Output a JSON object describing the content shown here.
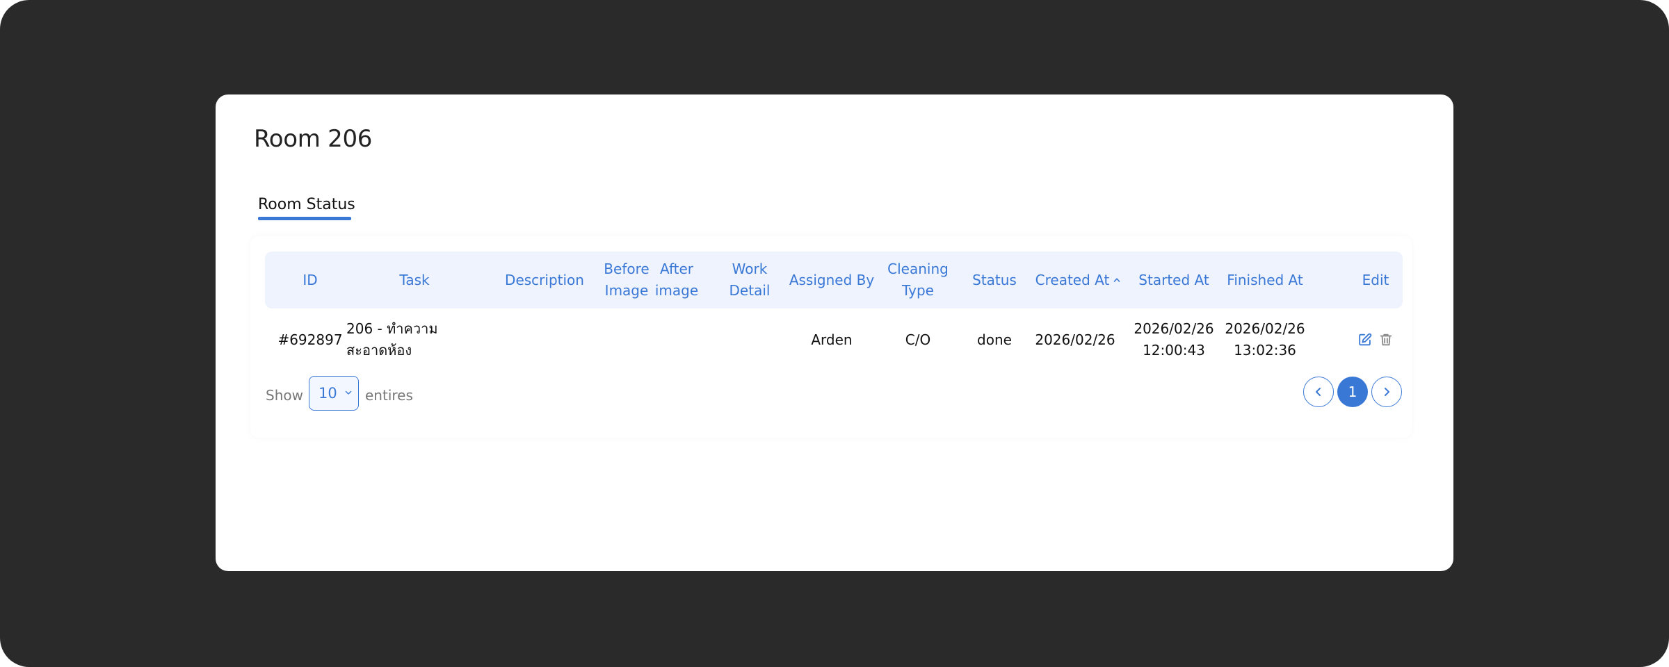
{
  "page": {
    "title": "Room 206"
  },
  "tabs": [
    {
      "label": "Room Status",
      "active": true
    }
  ],
  "table": {
    "columns": [
      "ID",
      "Task",
      "Description",
      "Before\nImage",
      "After\nimage",
      "Work\nDetail",
      "Assigned By",
      "Cleaning\nType",
      "Status",
      "Created At",
      "Started At",
      "Finished At",
      "Edit"
    ],
    "sorted_column": "Created At",
    "sort_direction": "ascending",
    "rows": [
      {
        "id": "#692897",
        "task": "206 - ทำความ\nสะอาดห้อง",
        "description": "",
        "before_image": "",
        "after_image": "",
        "work_detail": "",
        "assigned_by": "Arden",
        "cleaning_type": "C/O",
        "status": "done",
        "created_at": "2026/02/26",
        "started_at": "2026/02/26\n12:00:43",
        "finished_at": "2026/02/26\n13:02:36"
      }
    ]
  },
  "footer": {
    "show_label": "Show",
    "entries_value": "10",
    "entries_label": "entires"
  },
  "pagination": {
    "current_page": "1"
  },
  "icons": {
    "sort": "chevron-up-icon",
    "edit": "edit-icon",
    "delete": "trash-icon",
    "prev": "chevron-left-icon",
    "next": "chevron-right-icon",
    "select": "chevron-down-icon"
  },
  "colors": {
    "accent": "#3a78d6",
    "header_bg": "#eef3fe",
    "backdrop": "#2a2a2a"
  }
}
